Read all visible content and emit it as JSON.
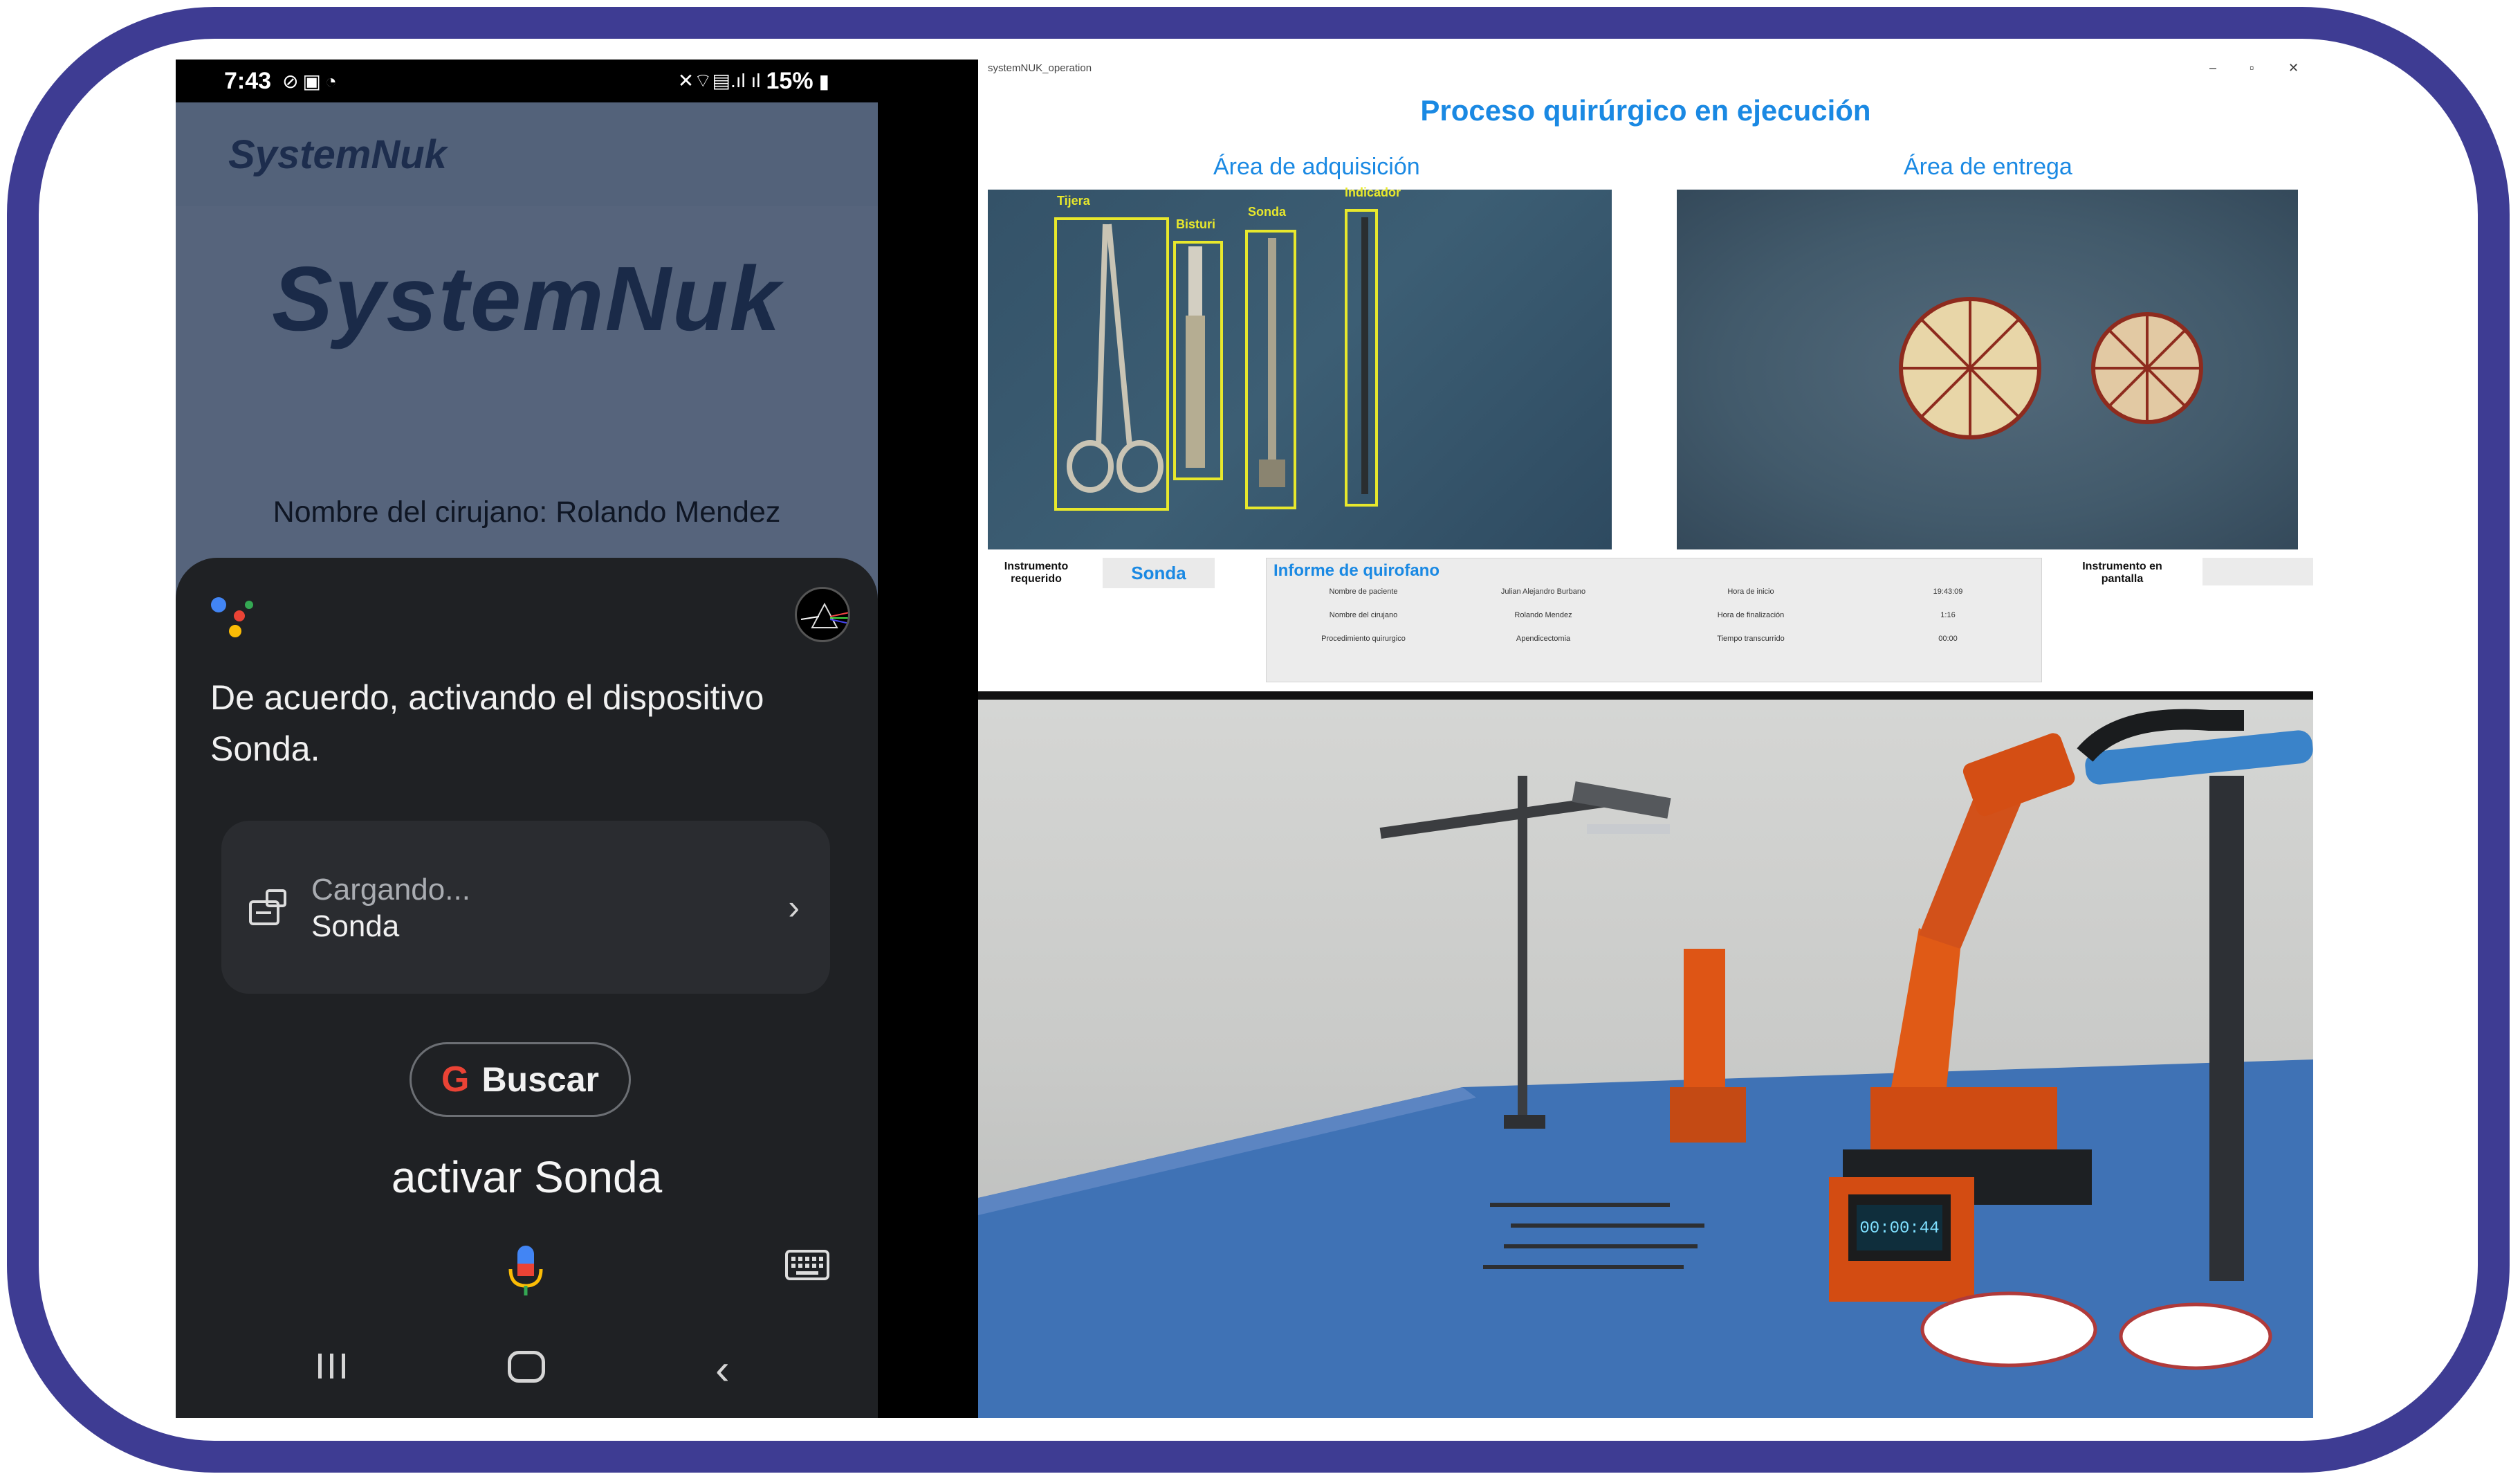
{
  "phone": {
    "status_bar": {
      "time": "7:43",
      "battery": "15%"
    },
    "app": {
      "topbar_title": "SystemNuk",
      "logo": "SystemNuk",
      "surgeon_line": "Nombre del cirujano: Rolando Mendez"
    },
    "assistant": {
      "response": "De acuerdo, activando el dispositivo Sonda.",
      "card_status": "Cargando...",
      "card_title": "Sonda",
      "search_label": "Buscar",
      "query": "activar Sonda"
    }
  },
  "window": {
    "title": "systemNUK_operation",
    "main_title": "Proceso quirúrgico en ejecución",
    "acquisition_label": "Área de adquisición",
    "delivery_label": "Área de entrega",
    "detections": [
      "Tijera",
      "Bisturi",
      "Sonda",
      "Indicador"
    ],
    "required_label": "Instrumento requerido",
    "required_value": "Sonda",
    "report": {
      "title": "Informe de quirofano",
      "rows": [
        [
          "Nombre de paciente",
          "Julian Alejandro Burbano",
          "Hora de inicio",
          "19:43:09"
        ],
        [
          "Nombre del cirujano",
          "Rolando Mendez",
          "Hora de finalización",
          "1:16"
        ],
        [
          "Procedimiento quirurgico",
          "Apendicectomia",
          "Tiempo transcurrido",
          "00:00"
        ]
      ]
    },
    "screen_label": "Instrumento en pantalla"
  },
  "video": {
    "display_time": "00:00:44"
  }
}
